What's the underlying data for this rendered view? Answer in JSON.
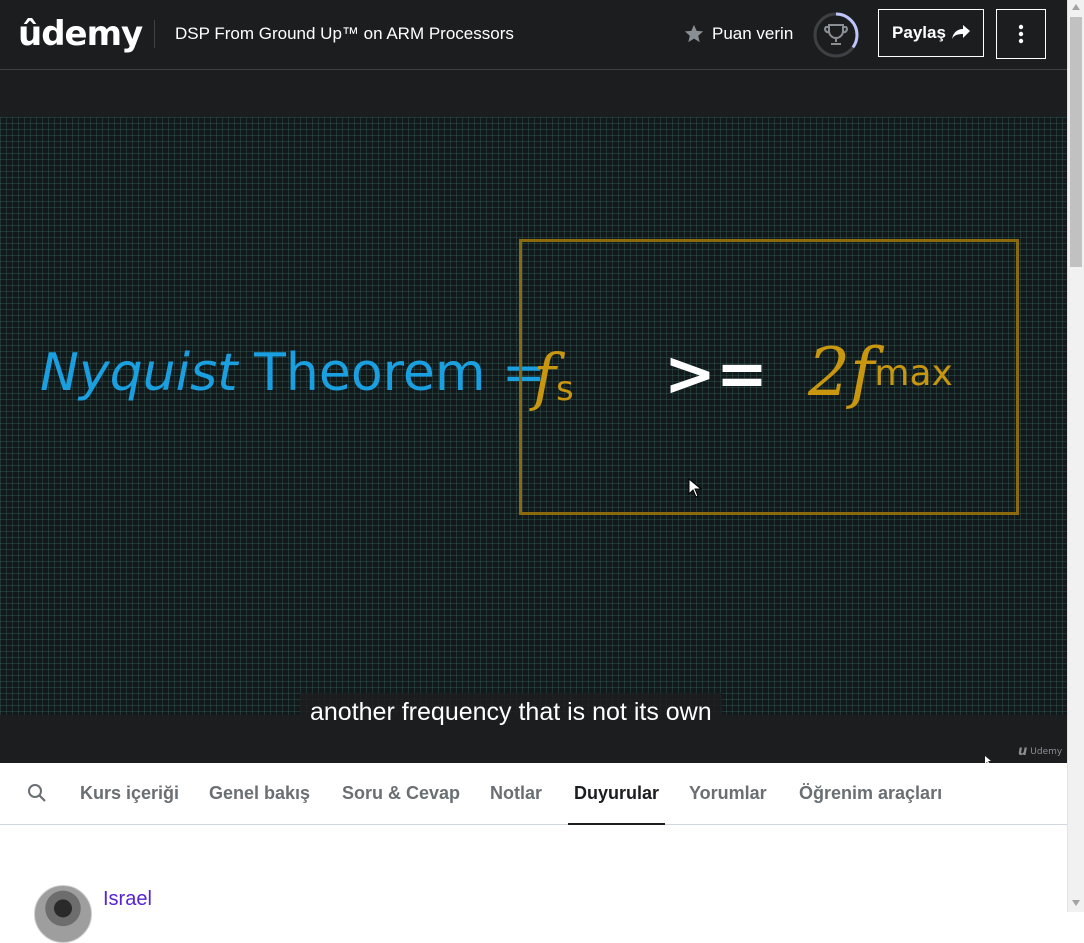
{
  "header": {
    "logo_text": "ûdemy",
    "course_title": "DSP From Ground Up™ on ARM Processors",
    "rate_label": "Puan verin",
    "share_label": "Paylaş",
    "icons": {
      "star": "star-icon",
      "trophy": "trophy-icon",
      "share": "share-arrow-icon",
      "more": "kebab-menu-icon"
    },
    "progress_fraction": 0.35
  },
  "video": {
    "slide": {
      "title_italic": "Nyquist",
      "title_rest": " Theorem =",
      "lhs_symbol": "f",
      "lhs_subscript": "s",
      "operator": ">=",
      "rhs_symbol": "2f",
      "rhs_subscript": "max"
    },
    "caption": "another frequency that is not its own",
    "watermark": "Udemy"
  },
  "tabs": {
    "items": [
      {
        "label": "Kurs içeriği",
        "name": "tab-course-content"
      },
      {
        "label": "Genel bakış",
        "name": "tab-overview"
      },
      {
        "label": "Soru & Cevap",
        "name": "tab-qa"
      },
      {
        "label": "Notlar",
        "name": "tab-notes"
      },
      {
        "label": "Duyurular",
        "name": "tab-announcements"
      },
      {
        "label": "Yorumlar",
        "name": "tab-reviews"
      },
      {
        "label": "Öğrenim araçları",
        "name": "tab-learning-tools"
      }
    ],
    "active": "Duyurular"
  },
  "announcement": {
    "author": "Israel"
  },
  "colors": {
    "header_bg": "#1c1d1f",
    "accent_purple": "#5624d0",
    "slide_blue": "#1a9fe0",
    "slide_gold": "#c8960f"
  }
}
